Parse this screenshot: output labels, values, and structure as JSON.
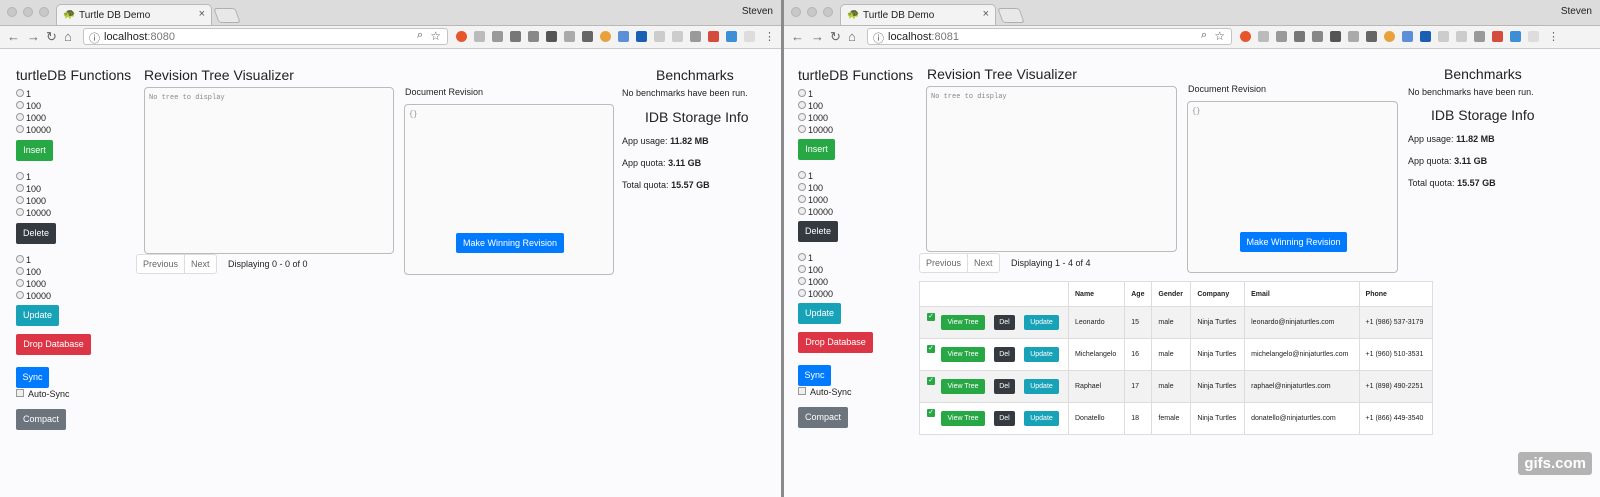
{
  "browser_user": "Steven",
  "tab_title": "Turtle DB Demo",
  "left": {
    "url_host": "localhost",
    "url_port": ":8080",
    "revision_pager_text": "Displaying 0 - 0 of 0"
  },
  "right": {
    "url_host": "localhost",
    "url_port": ":8081",
    "revision_pager_text": "Displaying 1 - 4 of 4"
  },
  "functions": {
    "heading": "turtleDB Functions",
    "radio_options": [
      "1",
      "100",
      "1000",
      "10000"
    ],
    "insert_label": "Insert",
    "delete_label": "Delete",
    "update_label": "Update",
    "drop_label": "Drop Database",
    "sync_label": "Sync",
    "autosync_label": "Auto-Sync",
    "compact_label": "Compact"
  },
  "visualizer": {
    "heading": "Revision Tree Visualizer",
    "placeholder": "No tree to display",
    "prev_label": "Previous",
    "next_label": "Next"
  },
  "doc_revision": {
    "label": "Document Revision",
    "content": "{}",
    "make_winning_label": "Make Winning Revision"
  },
  "benchmarks": {
    "heading": "Benchmarks",
    "empty_text": "No benchmarks have been run."
  },
  "storage": {
    "heading": "IDB Storage Info",
    "app_usage_label": "App usage:",
    "app_usage_value": "11.82 MB",
    "app_quota_label": "App quota:",
    "app_quota_value": "3.11 GB",
    "total_quota_label": "Total quota:",
    "total_quota_value": "15.57 GB"
  },
  "table": {
    "headers": [
      "",
      "Name",
      "Age",
      "Gender",
      "Company",
      "Email",
      "Phone"
    ],
    "view_label": "View Tree",
    "del_label": "Del",
    "update_label": "Update",
    "rows": [
      {
        "name": "Leonardo",
        "age": "15",
        "gender": "male",
        "company": "Ninja Turtles",
        "email": "leonardo@ninjaturtles.com",
        "phone": "+1 (986) 537-3179"
      },
      {
        "name": "Michelangelo",
        "age": "16",
        "gender": "male",
        "company": "Ninja Turtles",
        "email": "michelangelo@ninjaturtles.com",
        "phone": "+1 (960) 510-3531"
      },
      {
        "name": "Raphael",
        "age": "17",
        "gender": "male",
        "company": "Ninja Turtles",
        "email": "raphael@ninjaturtles.com",
        "phone": "+1 (898) 490-2251"
      },
      {
        "name": "Donatello",
        "age": "18",
        "gender": "female",
        "company": "Ninja Turtles",
        "email": "donatello@ninjaturtles.com",
        "phone": "+1 (866) 449-3540"
      }
    ]
  },
  "watermark": "gifs.com"
}
